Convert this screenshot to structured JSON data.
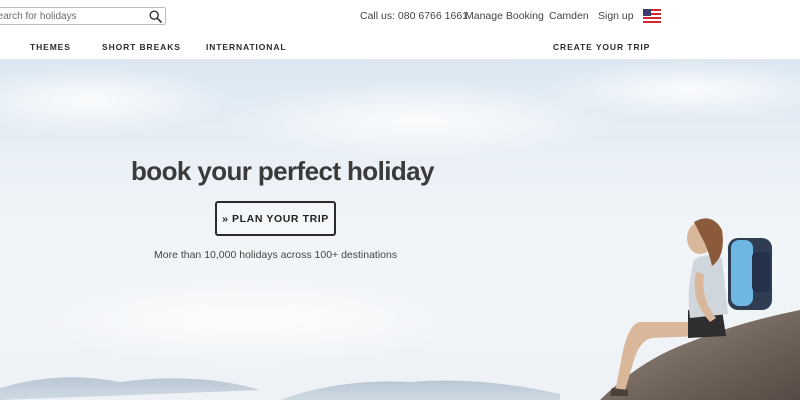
{
  "search": {
    "placeholder": "Search for holidays",
    "icon": "search-icon"
  },
  "utility_links": {
    "call": "Call us: 080 6766 1661",
    "manage_booking": "Manage Booking",
    "branch": "Camden",
    "sign_up": "Sign up",
    "country_flag_icon": "us-flag-icon"
  },
  "nav": {
    "items": [
      "THEMES",
      "SHORT BREAKS",
      "INTERNATIONAL"
    ],
    "create_trip": "CREATE YOUR TRIP"
  },
  "hero": {
    "headline": "book your perfect holiday",
    "cta_label": "» PLAN YOUR TRIP",
    "tagline": "More than 10,000 holidays across 100+ destinations"
  },
  "colors": {
    "sky_top": "#dbe7f2",
    "sky_bottom": "#eef2f6",
    "text_dark": "#3a3a3a",
    "backpack_blue": "#6fb7e3"
  }
}
